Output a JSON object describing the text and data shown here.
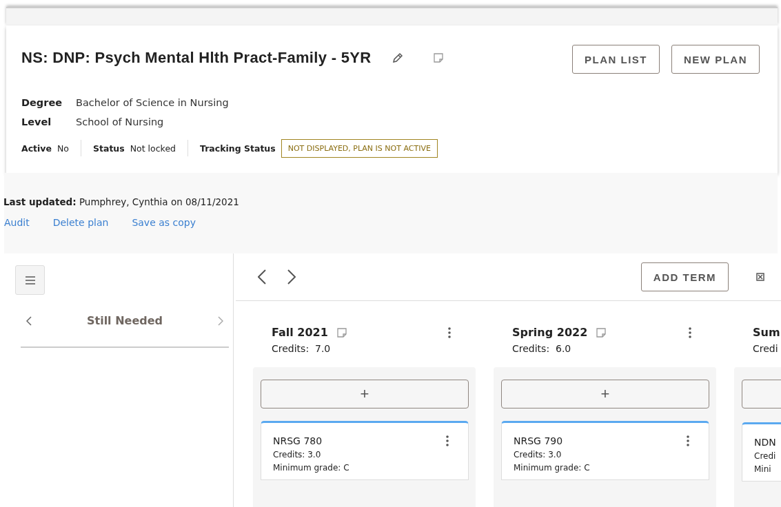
{
  "plan": {
    "title": "NS: DNP: Psych Mental Hlth Pract-Family - 5YR",
    "buttons": [
      "PLAN LIST",
      "NEW PLAN"
    ],
    "details": [
      {
        "label": "Degree",
        "value": "Bachelor of Science in Nursing"
      },
      {
        "label": "Level",
        "value": "School of Nursing"
      }
    ],
    "statuses": [
      {
        "label": "Active",
        "value": "No"
      },
      {
        "label": "Status",
        "value": "Not locked"
      }
    ],
    "tracking": {
      "label": "Tracking Status",
      "badge": "NOT DISPLAYED, PLAN IS NOT ACTIVE"
    }
  },
  "updated": {
    "label": "Last updated:",
    "value": "Pumphrey, Cynthia on 08/11/2021"
  },
  "links": [
    "Audit",
    "Delete plan",
    "Save as copy"
  ],
  "sidebar": {
    "title": "Still Needed"
  },
  "toolbar": {
    "add_button": "ADD TERM"
  },
  "terms": [
    {
      "name": "Fall 2021",
      "credits_label": "Credits:",
      "credits": "7.0",
      "has_note": true,
      "has_menu": true,
      "add_label": "+",
      "courses": [
        {
          "code": "NRSG 780",
          "credits": "Credits: 3.0",
          "grade": "Minimum grade: C",
          "has_menu": true
        }
      ]
    },
    {
      "name": "Spring 2022",
      "credits_label": "Credits:",
      "credits": "6.0",
      "has_note": true,
      "has_menu": true,
      "add_label": "+",
      "courses": [
        {
          "code": "NRSG 790",
          "credits": "Credits: 3.0",
          "grade": "Minimum grade: C",
          "has_menu": true
        }
      ]
    },
    {
      "name": "Sum",
      "credits_label": "Credi",
      "has_note": false,
      "has_menu": false,
      "courses": [
        {
          "code": "NDN",
          "credits": "Credi",
          "grade": "Mini",
          "has_menu": false
        }
      ]
    }
  ]
}
